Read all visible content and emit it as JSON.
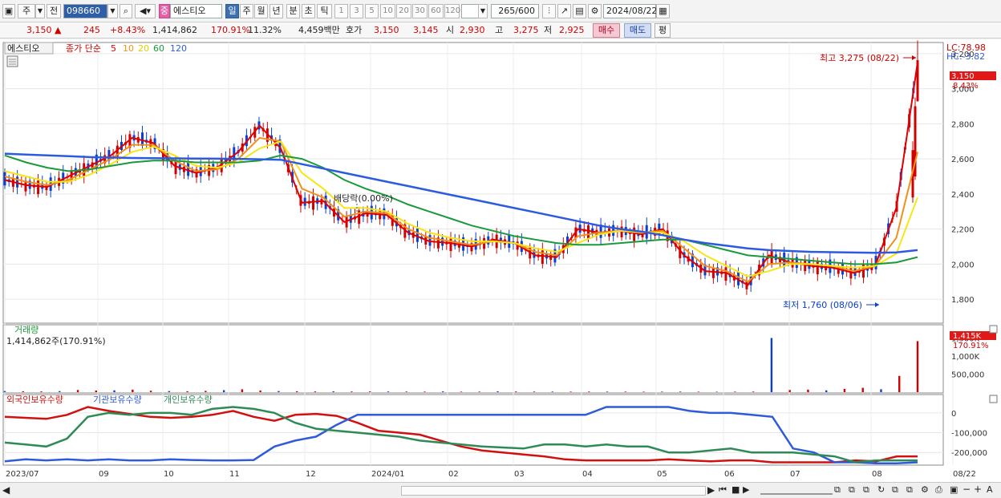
{
  "toolbar": {
    "type_label": "주",
    "prev_label": "전",
    "code": "098660",
    "stock_badge": "중",
    "stock_name": "에스티오",
    "periods": [
      "일",
      "주",
      "월",
      "년",
      "분",
      "초",
      "틱"
    ],
    "selected_period": "일",
    "intervals": [
      "1",
      "3",
      "5",
      "10",
      "20",
      "30",
      "60",
      "120"
    ],
    "count": "265",
    "count_total": "/600",
    "date": "2024/08/22"
  },
  "quote": {
    "price": "3,150",
    "change": "245",
    "change_pct": "+8.43%",
    "volume": "1,414,862",
    "volume_ratio": "170.91%",
    "turnover": "11.32%",
    "amount": "4,459백만",
    "hoga_label": "호가",
    "ask": "3,150",
    "bid": "3,145",
    "open_label": "시",
    "open": "2,930",
    "high_label": "고",
    "high": "3,275",
    "low_label": "저",
    "low": "2,925",
    "buy_label": "매수",
    "sell_label": "매도",
    "eval_label": "평"
  },
  "price_panel": {
    "name_label": "에스티오",
    "ma_label": "종가 단순",
    "ma_periods": [
      "5",
      "10",
      "20",
      "60",
      "120"
    ],
    "lc": "LC:78.98",
    "hc": "HC:-3.82",
    "current_tag": "3,150",
    "current_pct": "8.43%",
    "high_note": "최고 3,275 (08/22)",
    "low_note": "최저 1,760 (08/06)",
    "dividend_note": "배당락(0.00%)",
    "y_ticks": [
      "3,200",
      "3,000",
      "2,800",
      "2,600",
      "2,400",
      "2,200",
      "2,000",
      "1,800"
    ]
  },
  "volume_panel": {
    "title": "거래량",
    "value_text": "1,414,862주(170.91%)",
    "tag": "1,415K",
    "tag_pct": "170.91%",
    "y_ticks": [
      "1,500K",
      "1,000K",
      "500,000"
    ]
  },
  "holdings_panel": {
    "legend": [
      "외국인보유수량",
      "기관보유수량",
      "개인보유수량"
    ],
    "y_ticks": [
      "0",
      "-100,000",
      "-200,000"
    ]
  },
  "x_labels": [
    "2023/07",
    "09",
    "10",
    "11",
    "12",
    "2024/01",
    "02",
    "03",
    "04",
    "05",
    "06",
    "07",
    "08",
    "08/22"
  ],
  "colors": {
    "up": "#d10000",
    "down": "#0a3fd0",
    "ma5": "#e00000",
    "ma10": "#f0901a",
    "ma20": "#f6e614",
    "ma60": "#1a9a3a",
    "ma120": "#2c5be0",
    "foreign": "#d11010",
    "institution": "#2f5bd8",
    "individual": "#2e8b57"
  },
  "chart_data": [
    {
      "type": "candlestick",
      "title": "에스티오",
      "x_range": [
        "2023/07",
        "2024/08/22"
      ],
      "ylim": [
        1700,
        3300
      ],
      "series": [
        {
          "name": "5",
          "values": [
            2480,
            2450,
            2440,
            2500,
            2560,
            2620,
            2720,
            2690,
            2560,
            2520,
            2550,
            2640,
            2790,
            2660,
            2350,
            2360,
            2240,
            2290,
            2280,
            2180,
            2130,
            2120,
            2100,
            2140,
            2120,
            2050,
            2040,
            2200,
            2180,
            2190,
            2170,
            2200,
            2050,
            1960,
            1950,
            1880,
            2050,
            2010,
            1990,
            1980,
            1950,
            1990,
            2320,
            3150
          ]
        },
        {
          "name": "10",
          "values": [
            2500,
            2470,
            2450,
            2480,
            2540,
            2600,
            2680,
            2680,
            2590,
            2530,
            2540,
            2600,
            2720,
            2700,
            2430,
            2380,
            2270,
            2300,
            2290,
            2200,
            2150,
            2130,
            2110,
            2130,
            2120,
            2070,
            2050,
            2160,
            2180,
            2190,
            2180,
            2190,
            2090,
            1990,
            1960,
            1900,
            2000,
            2010,
            2000,
            1990,
            1960,
            1990,
            2150,
            2640
          ]
        },
        {
          "name": "20",
          "values": [
            2530,
            2500,
            2470,
            2470,
            2510,
            2570,
            2640,
            2670,
            2620,
            2560,
            2550,
            2580,
            2660,
            2700,
            2520,
            2430,
            2320,
            2320,
            2300,
            2230,
            2180,
            2150,
            2130,
            2130,
            2120,
            2090,
            2070,
            2120,
            2170,
            2190,
            2180,
            2180,
            2130,
            2050,
            1990,
            1930,
            1960,
            2000,
            2000,
            1990,
            1980,
            1990,
            2060,
            2380
          ]
        },
        {
          "name": "60",
          "values": [
            2620,
            2580,
            2550,
            2530,
            2540,
            2560,
            2580,
            2590,
            2590,
            2580,
            2580,
            2580,
            2590,
            2620,
            2600,
            2550,
            2480,
            2430,
            2390,
            2340,
            2300,
            2260,
            2220,
            2190,
            2160,
            2140,
            2120,
            2110,
            2110,
            2120,
            2130,
            2140,
            2140,
            2110,
            2080,
            2050,
            2040,
            2030,
            2020,
            2010,
            2000,
            2000,
            2010,
            2040
          ]
        },
        {
          "name": "120",
          "values": [
            2630,
            2625,
            2620,
            2615,
            2610,
            2608,
            2605,
            2604,
            2603,
            2602,
            2601,
            2600,
            2598,
            2595,
            2570,
            2545,
            2520,
            2495,
            2470,
            2445,
            2420,
            2395,
            2370,
            2345,
            2320,
            2295,
            2270,
            2245,
            2220,
            2200,
            2185,
            2165,
            2140,
            2120,
            2105,
            2090,
            2080,
            2075,
            2070,
            2068,
            2066,
            2065,
            2067,
            2080
          ]
        }
      ],
      "high": {
        "value": 3275,
        "date": "08/22"
      },
      "low": {
        "value": 1760,
        "date": "08/06"
      },
      "current": 3150
    },
    {
      "type": "bar",
      "title": "거래량",
      "ylim": [
        0,
        1600000
      ],
      "values": [
        30000,
        25000,
        20000,
        28000,
        60000,
        45000,
        50000,
        70000,
        40000,
        30000,
        25000,
        35000,
        55000,
        80000,
        45000,
        30000,
        25000,
        20000,
        22000,
        18000,
        20000,
        18000,
        16000,
        15000,
        20000,
        14000,
        15000,
        22000,
        18000,
        16000,
        15000,
        14000,
        16000,
        15000,
        14000,
        13000,
        14000,
        15000,
        13000,
        12000,
        14000,
        16000,
        1500000,
        60000,
        70000,
        50000,
        90000,
        120000,
        80000,
        450000,
        1414862
      ]
    },
    {
      "type": "line",
      "title": "외국인보유수량 / 기관보유수량 / 개인보유수량",
      "ylim": [
        -260000,
        40000
      ],
      "series": [
        {
          "name": "외국인보유수량",
          "values": [
            -20000,
            -25000,
            -30000,
            -10000,
            30000,
            10000,
            -5000,
            -20000,
            -25000,
            -20000,
            -10000,
            10000,
            -20000,
            -40000,
            -10000,
            -5000,
            -15000,
            -50000,
            -90000,
            -100000,
            -110000,
            -140000,
            -170000,
            -190000,
            -200000,
            -210000,
            -220000,
            -235000,
            -240000,
            -240000,
            -240000,
            -240000,
            -235000,
            -240000,
            -245000,
            -240000,
            -240000,
            -250000,
            -250000,
            -250000,
            -250000,
            -240000,
            -245000,
            -220000,
            -220000
          ]
        },
        {
          "name": "기관보유수량",
          "values": [
            -245000,
            -235000,
            -240000,
            -235000,
            -240000,
            -235000,
            -240000,
            -240000,
            -235000,
            -238000,
            -240000,
            -240000,
            -238000,
            -170000,
            -140000,
            -120000,
            -60000,
            -10000,
            -10000,
            -10000,
            -10000,
            -10000,
            -10000,
            -10000,
            -10000,
            -10000,
            -10000,
            -10000,
            -10000,
            30000,
            30000,
            30000,
            30000,
            10000,
            0,
            0,
            -10000,
            -20000,
            -180000,
            -200000,
            -250000,
            -250000,
            -255000,
            -255000,
            -250000
          ]
        },
        {
          "name": "개인보유수량",
          "values": [
            -150000,
            -160000,
            -170000,
            -130000,
            -20000,
            0,
            -10000,
            0,
            0,
            -10000,
            20000,
            30000,
            20000,
            0,
            -50000,
            -80000,
            -90000,
            -100000,
            -110000,
            -120000,
            -140000,
            -150000,
            -160000,
            -170000,
            -175000,
            -180000,
            -160000,
            -160000,
            -170000,
            -160000,
            -170000,
            -170000,
            -200000,
            -200000,
            -190000,
            -180000,
            -200000,
            -200000,
            -200000,
            -210000,
            -220000,
            -250000,
            -240000,
            -240000,
            -240000
          ]
        }
      ]
    }
  ]
}
